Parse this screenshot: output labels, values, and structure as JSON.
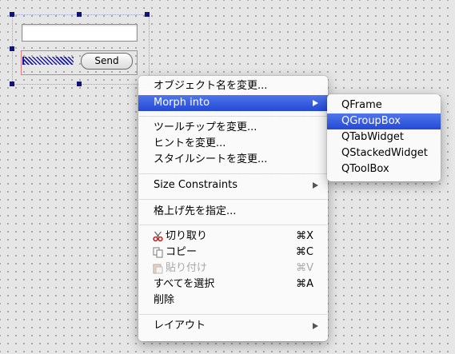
{
  "form": {
    "send_button": "Send",
    "line_edit_value": ""
  },
  "context_menu": {
    "change_object_name": "オブジェクト名を変更...",
    "morph_into": "Morph into",
    "change_tooltip": "ツールチップを変更...",
    "change_hint": "ヒントを変更...",
    "change_stylesheet": "スタイルシートを変更...",
    "size_constraints": "Size Constraints",
    "promote_to": "格上げ先を指定...",
    "cut": "切り取り",
    "cut_shortcut": "⌘X",
    "copy": "コピー",
    "copy_shortcut": "⌘C",
    "paste": "貼り付け",
    "paste_shortcut": "⌘V",
    "select_all": "すべてを選択",
    "select_all_shortcut": "⌘A",
    "delete": "削除",
    "layout": "レイアウト"
  },
  "morph_submenu": {
    "items": [
      "QFrame",
      "QGroupBox",
      "QTabWidget",
      "QStackedWidget",
      "QToolBox"
    ],
    "highlighted": "QGroupBox"
  },
  "colors": {
    "highlight": "#2a4fd9",
    "selection_handle": "#12127a",
    "layout_border": "#e07a7a"
  },
  "icons": {
    "cut": "scissors-icon",
    "copy": "copy-documents-icon",
    "paste": "clipboard-icon",
    "submenu": "chevron-right-icon"
  }
}
